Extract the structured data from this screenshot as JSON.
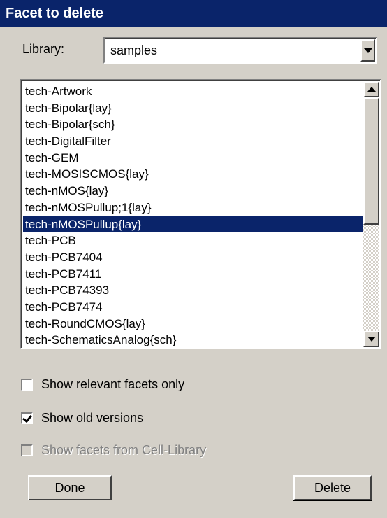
{
  "window": {
    "title": "Facet to delete"
  },
  "library": {
    "label": "Library:",
    "selected": "samples"
  },
  "facets": {
    "items": [
      "tech-Artwork",
      "tech-Bipolar{lay}",
      "tech-Bipolar{sch}",
      "tech-DigitalFilter",
      "tech-GEM",
      "tech-MOSISCMOS{lay}",
      "tech-nMOS{lay}",
      "tech-nMOSPullup;1{lay}",
      "tech-nMOSPullup{lay}",
      "tech-PCB",
      "tech-PCB7404",
      "tech-PCB7411",
      "tech-PCB74393",
      "tech-PCB7474",
      "tech-RoundCMOS{lay}",
      "tech-SchematicsAnalog{sch}"
    ],
    "selected_index": 8
  },
  "options": {
    "relevant": {
      "label": "Show relevant facets only",
      "checked": false
    },
    "old_versions": {
      "label": "Show old versions",
      "checked": true
    },
    "cell_library": {
      "label": "Show facets from Cell-Library",
      "checked": false,
      "enabled": false
    }
  },
  "buttons": {
    "done": "Done",
    "delete": "Delete"
  },
  "colors": {
    "selection": "#0a246a",
    "face": "#d4d0c8"
  }
}
